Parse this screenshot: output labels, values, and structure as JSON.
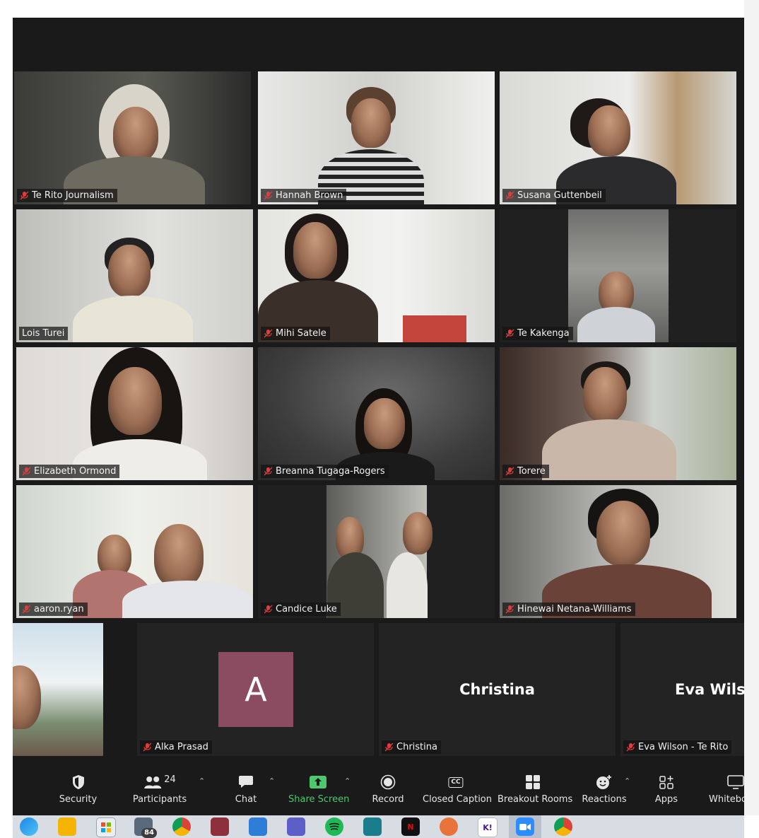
{
  "participants": {
    "row1": [
      {
        "name": "Te Rito Journalism"
      },
      {
        "name": "Hannah Brown"
      },
      {
        "name": "Susana Guttenbeil"
      }
    ],
    "row2": [
      {
        "name": "Lois Turei"
      },
      {
        "name": "Mihi Satele"
      },
      {
        "name": "Te Kakenga"
      }
    ],
    "row3": [
      {
        "name": "Elizabeth Ormond"
      },
      {
        "name": "Breanna Tugaga-Rogers"
      },
      {
        "name": "Torere"
      }
    ],
    "row4": [
      {
        "name": "aaron.ryan"
      },
      {
        "name": "Candice Luke"
      },
      {
        "name": "Hinewai Netana-Williams"
      }
    ],
    "row5": [
      {
        "name": "Alka Prasad",
        "avatar_letter": "A"
      },
      {
        "name": "Christina",
        "display_name": "Christina"
      },
      {
        "name": "Eva Wilson - Te Rito",
        "display_name": "Eva Wilso"
      }
    ]
  },
  "toolbar": {
    "security": "Security",
    "participants": "Participants",
    "participants_count": "24",
    "chat": "Chat",
    "share_screen": "Share Screen",
    "record": "Record",
    "closed_caption": "Closed Caption",
    "cc_glyph": "CC",
    "breakout_rooms": "Breakout Rooms",
    "reactions": "Reactions",
    "apps": "Apps",
    "whiteboard": "Whitebo"
  },
  "taskbar": {
    "mail_badge": "84",
    "netflix_glyph": "N",
    "kahoot_glyph": "K!"
  },
  "colors": {
    "avatar_bg": "#8b4b61",
    "share_green": "#4fc76f",
    "active_speaker": "#8fc63f"
  }
}
